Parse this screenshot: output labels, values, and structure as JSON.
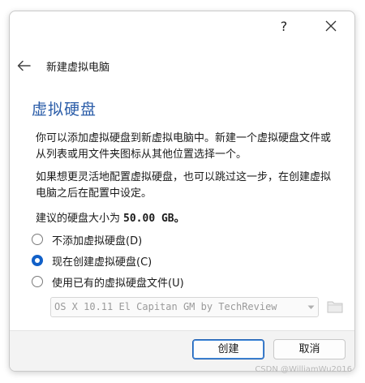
{
  "window": {
    "help_label": "?",
    "close_icon": "close-icon"
  },
  "nav": {
    "back_icon": "arrow-left-icon",
    "title": "新建虚拟电脑"
  },
  "page": {
    "heading": "虚拟硬盘",
    "paragraph1": "你可以添加虚拟硬盘到新虚拟电脑中。新建一个虚拟硬盘文件或从列表或用文件夹图标从其他位置选择一个。",
    "paragraph2": "如果想更灵活地配置虚拟硬盘，也可以跳过这一步，在创建虚拟电脑之后在配置中设定。",
    "suggest_prefix": "建议的硬盘大小为",
    "suggest_size": "50.00 GB。"
  },
  "options": [
    {
      "label": "不添加虚拟硬盘(D)",
      "checked": false
    },
    {
      "label": "现在创建虚拟硬盘(C)",
      "checked": true
    },
    {
      "label": "使用已有的虚拟硬盘文件(U)",
      "checked": false
    }
  ],
  "existing_disk": {
    "selected": "OS X 10.11 El Capitan GM by TechReview",
    "enabled": false
  },
  "footer": {
    "create_label": "创建",
    "cancel_label": "取消"
  },
  "watermark": "CSDN @WilliamWu2016",
  "colors": {
    "accent": "#1160c8",
    "heading": "#2a5ca8"
  }
}
